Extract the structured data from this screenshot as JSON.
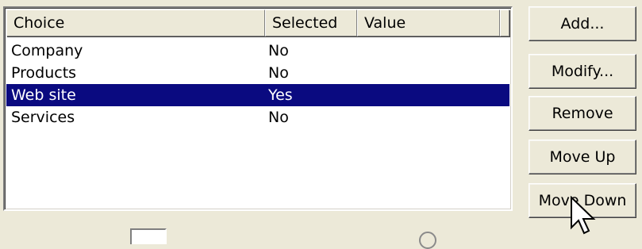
{
  "list": {
    "columns": [
      "Choice",
      "Selected",
      "Value"
    ],
    "rows": [
      {
        "choice": "Company",
        "selected": "No",
        "value": ""
      },
      {
        "choice": "Products",
        "selected": "No",
        "value": ""
      },
      {
        "choice": "Web site",
        "selected": "Yes",
        "value": ""
      },
      {
        "choice": "Services",
        "selected": "No",
        "value": ""
      }
    ],
    "selected_row": "Web site",
    "selection_color": "#0a0a80"
  },
  "buttons": {
    "add": "Add...",
    "modify": "Modify...",
    "remove": "Remove",
    "move_up": "Move Up",
    "move_down": "Move Down"
  },
  "icons": {
    "cursor": "arrow-pointer-icon"
  }
}
